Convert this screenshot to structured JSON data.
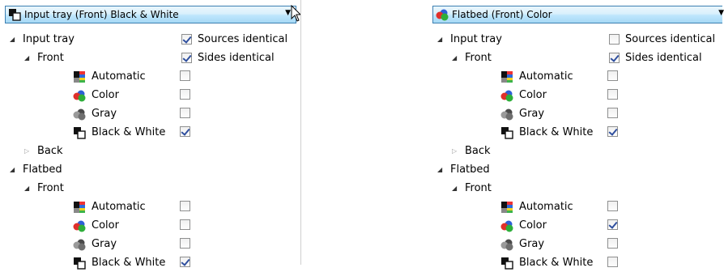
{
  "left": {
    "combo_text": "Input tray (Front) Black & White",
    "sources_identical": {
      "label": "Sources identical",
      "checked": true
    },
    "sides_identical": {
      "label": "Sides identical",
      "checked": true
    },
    "input_tray": {
      "label": "Input tray",
      "front_label": "Front",
      "modes": [
        {
          "label": "Automatic",
          "icon": "automatic-icon",
          "checked": false
        },
        {
          "label": "Color",
          "icon": "color-icon",
          "checked": false
        },
        {
          "label": "Gray",
          "icon": "gray-icon",
          "checked": false
        },
        {
          "label": "Black & White",
          "icon": "black-white-icon",
          "checked": true
        }
      ],
      "back_label": "Back"
    },
    "flatbed": {
      "label": "Flatbed",
      "front_label": "Front",
      "modes": [
        {
          "label": "Automatic",
          "icon": "automatic-icon",
          "checked": false
        },
        {
          "label": "Color",
          "icon": "color-icon",
          "checked": false
        },
        {
          "label": "Gray",
          "icon": "gray-icon",
          "checked": false
        },
        {
          "label": "Black & White",
          "icon": "black-white-icon",
          "checked": true
        }
      ]
    }
  },
  "right": {
    "combo_text": "Flatbed (Front) Color",
    "sources_identical": {
      "label": "Sources identical",
      "checked": false
    },
    "sides_identical": {
      "label": "Sides identical",
      "checked": true
    },
    "input_tray": {
      "label": "Input tray",
      "front_label": "Front",
      "modes": [
        {
          "label": "Automatic",
          "icon": "automatic-icon",
          "checked": false
        },
        {
          "label": "Color",
          "icon": "color-icon",
          "checked": false
        },
        {
          "label": "Gray",
          "icon": "gray-icon",
          "checked": false
        },
        {
          "label": "Black & White",
          "icon": "black-white-icon",
          "checked": true
        }
      ],
      "back_label": "Back"
    },
    "flatbed": {
      "label": "Flatbed",
      "front_label": "Front",
      "modes": [
        {
          "label": "Automatic",
          "icon": "automatic-icon",
          "checked": false
        },
        {
          "label": "Color",
          "icon": "color-icon",
          "checked": true
        },
        {
          "label": "Gray",
          "icon": "gray-icon",
          "checked": false
        },
        {
          "label": "Black & White",
          "icon": "black-white-icon",
          "checked": false
        }
      ]
    }
  },
  "colors": {
    "combo_border": "#3c7fb1",
    "check": "#2f4f9e"
  }
}
